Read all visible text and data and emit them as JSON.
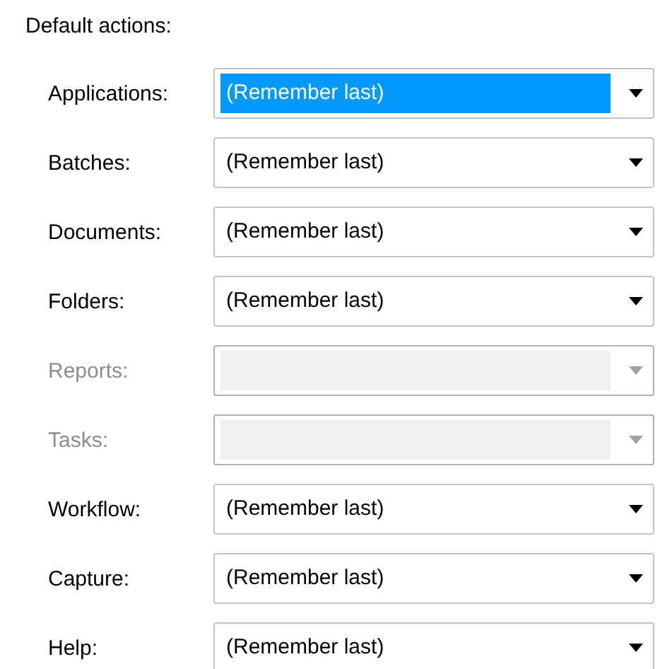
{
  "section_title": "Default actions:",
  "fields": [
    {
      "label": "Applications:",
      "value": "(Remember last)",
      "disabled": false,
      "focused": true
    },
    {
      "label": "Batches:",
      "value": "(Remember last)",
      "disabled": false,
      "focused": false
    },
    {
      "label": "Documents:",
      "value": "(Remember last)",
      "disabled": false,
      "focused": false
    },
    {
      "label": "Folders:",
      "value": "(Remember last)",
      "disabled": false,
      "focused": false
    },
    {
      "label": "Reports:",
      "disabled": true,
      "focused": false
    },
    {
      "label": "Tasks:",
      "disabled": true,
      "focused": false
    },
    {
      "label": "Workflow:",
      "value": "(Remember last)",
      "disabled": false,
      "focused": false
    },
    {
      "label": "Capture:",
      "value": "(Remember last)",
      "disabled": false,
      "focused": false
    },
    {
      "label": "Help:",
      "value": "(Remember last)",
      "disabled": false,
      "focused": false
    }
  ]
}
